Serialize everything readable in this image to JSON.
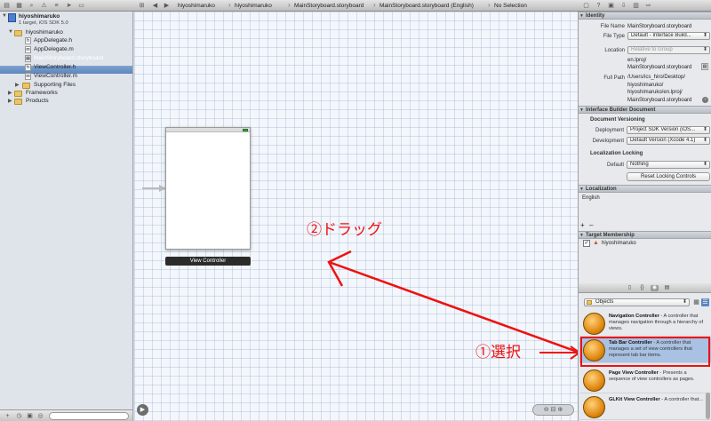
{
  "breadcrumb": [
    "hiyoshimaruko",
    "hiyoshimaruko",
    "MainStoryboard.storyboard",
    "MainStoryboard.storyboard (English)",
    "No Selection"
  ],
  "navigator": {
    "project_name": "hiyoshimaruko",
    "project_sub": "1 target, iOS SDK 5.0",
    "items": [
      {
        "label": "hiyoshimaruko",
        "kind": "folder-icon"
      },
      {
        "label": "AppDelegate.h",
        "kind": "header-file-icon"
      },
      {
        "label": "AppDelegate.m",
        "kind": "source-file-icon"
      },
      {
        "label": "MainStoryboard.storyboard",
        "kind": "storyboard-file-icon"
      },
      {
        "label": "ViewController.h",
        "kind": "header-file-icon"
      },
      {
        "label": "ViewController.m",
        "kind": "source-file-icon"
      },
      {
        "label": "Supporting Files",
        "kind": "folder-icon"
      },
      {
        "label": "Frameworks",
        "kind": "folder-icon"
      },
      {
        "label": "Products",
        "kind": "folder-icon"
      }
    ]
  },
  "canvas": {
    "scene_label": "View Controller",
    "annotation_drag": "②ドラッグ",
    "annotation_select": "①選択"
  },
  "inspector": {
    "identity_title": "Identity",
    "file_name_label": "File Name",
    "file_name_value": "MainStoryboard.storyboard",
    "file_type_label": "File Type",
    "file_type_value": "Default - Interface Build...",
    "location_label": "Location",
    "location_value": "Relative to Group",
    "location_path": [
      "en.lproj/",
      "MainStoryboard.storyboard"
    ],
    "full_path_label": "Full Path",
    "full_path_value": [
      "/Users/ics_hiro/Desktop/",
      "hiyoshimaruko/",
      "hiyoshimaruko/en.lproj/",
      "MainStoryboard.storyboard"
    ],
    "ibdoc_title": "Interface Builder Document",
    "doc_versioning": "Document Versioning",
    "deployment_label": "Deployment",
    "deployment_value": "Project SDK Version (iOS...",
    "development_label": "Development",
    "development_value": "Default Version (Xcode 4.1)",
    "loc_locking": "Localization Locking",
    "default_label": "Default",
    "default_value": "Nothing",
    "reset_button": "Reset Locking Controls",
    "localization_title": "Localization",
    "localization_value": "English",
    "add_button": "+",
    "remove_button": "–",
    "target_title": "Target Membership",
    "target_value": "hiyoshimaruko"
  },
  "library": {
    "filter_value": "Objects",
    "items": [
      {
        "title": "Navigation Controller",
        "desc": " - A controller that manages navigation through a hierarchy of views."
      },
      {
        "title": "Tab Bar Controller",
        "desc": " - A controller that manages a set of view controllers that represent tab bar items."
      },
      {
        "title": "Page View Controller",
        "desc": " - Presents a sequence of view controllers as pages."
      },
      {
        "title": "GLKit View Controller",
        "desc": " - A controller that..."
      }
    ]
  }
}
